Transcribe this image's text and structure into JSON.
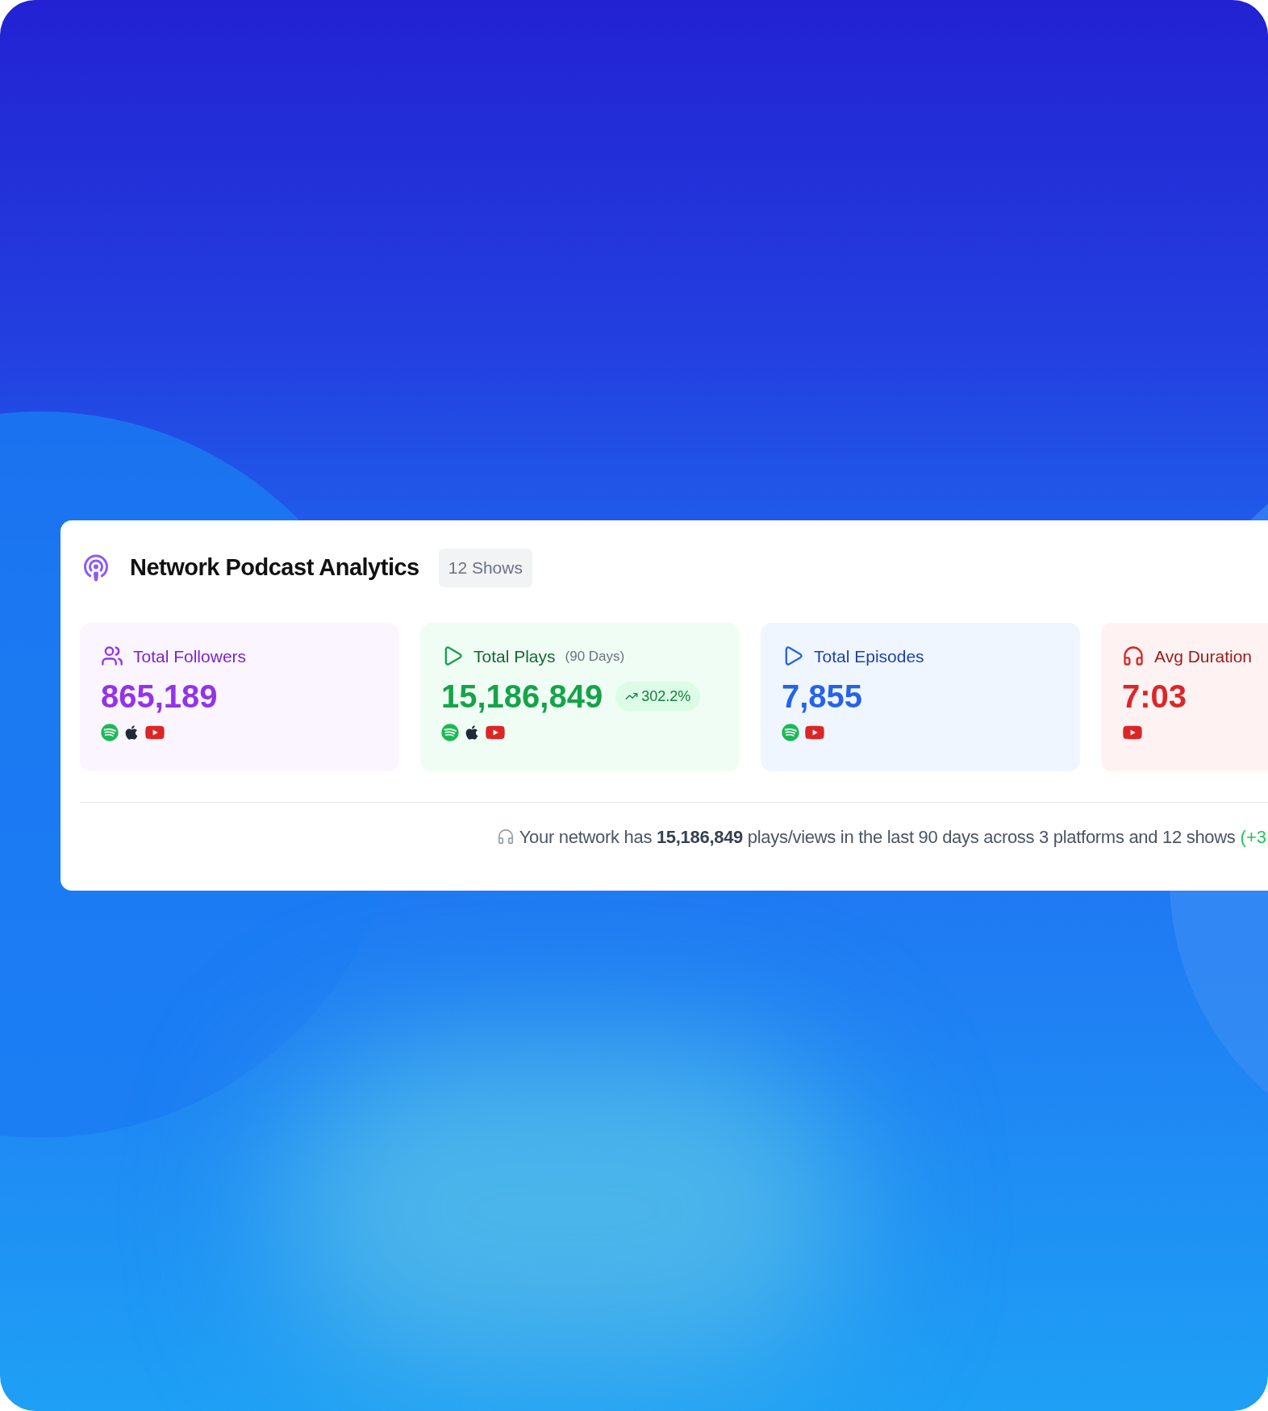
{
  "header": {
    "title": "Network Podcast Analytics",
    "badge": "12 Shows"
  },
  "stats": [
    {
      "kind": "followers",
      "label": "Total Followers",
      "value": "865,189",
      "color": "#9333ea",
      "platforms": [
        {
          "kind": "spotify"
        },
        {
          "kind": "apple"
        },
        {
          "kind": "youtube"
        }
      ]
    },
    {
      "kind": "plays",
      "label": "Total Plays",
      "sublabel": "(90 Days)",
      "value": "15,186,849",
      "change": "302.2%",
      "color": "#16a34a",
      "platforms": [
        {
          "kind": "spotify"
        },
        {
          "kind": "apple"
        },
        {
          "kind": "youtube"
        }
      ]
    },
    {
      "kind": "episodes",
      "label": "Total Episodes",
      "value": "7,855",
      "color": "#2563eb",
      "platforms": [
        {
          "kind": "spotify"
        },
        {
          "kind": "youtube"
        }
      ]
    },
    {
      "kind": "duration",
      "label": "Avg Duration",
      "value": "7:03",
      "color": "#dc2626",
      "platforms": [
        {
          "kind": "youtube"
        }
      ]
    }
  ],
  "footer": {
    "text": "Your network has **15,186,849** plays/views in the last 90 days across 3 platforms and 12 shows",
    "extra": "(+3"
  }
}
